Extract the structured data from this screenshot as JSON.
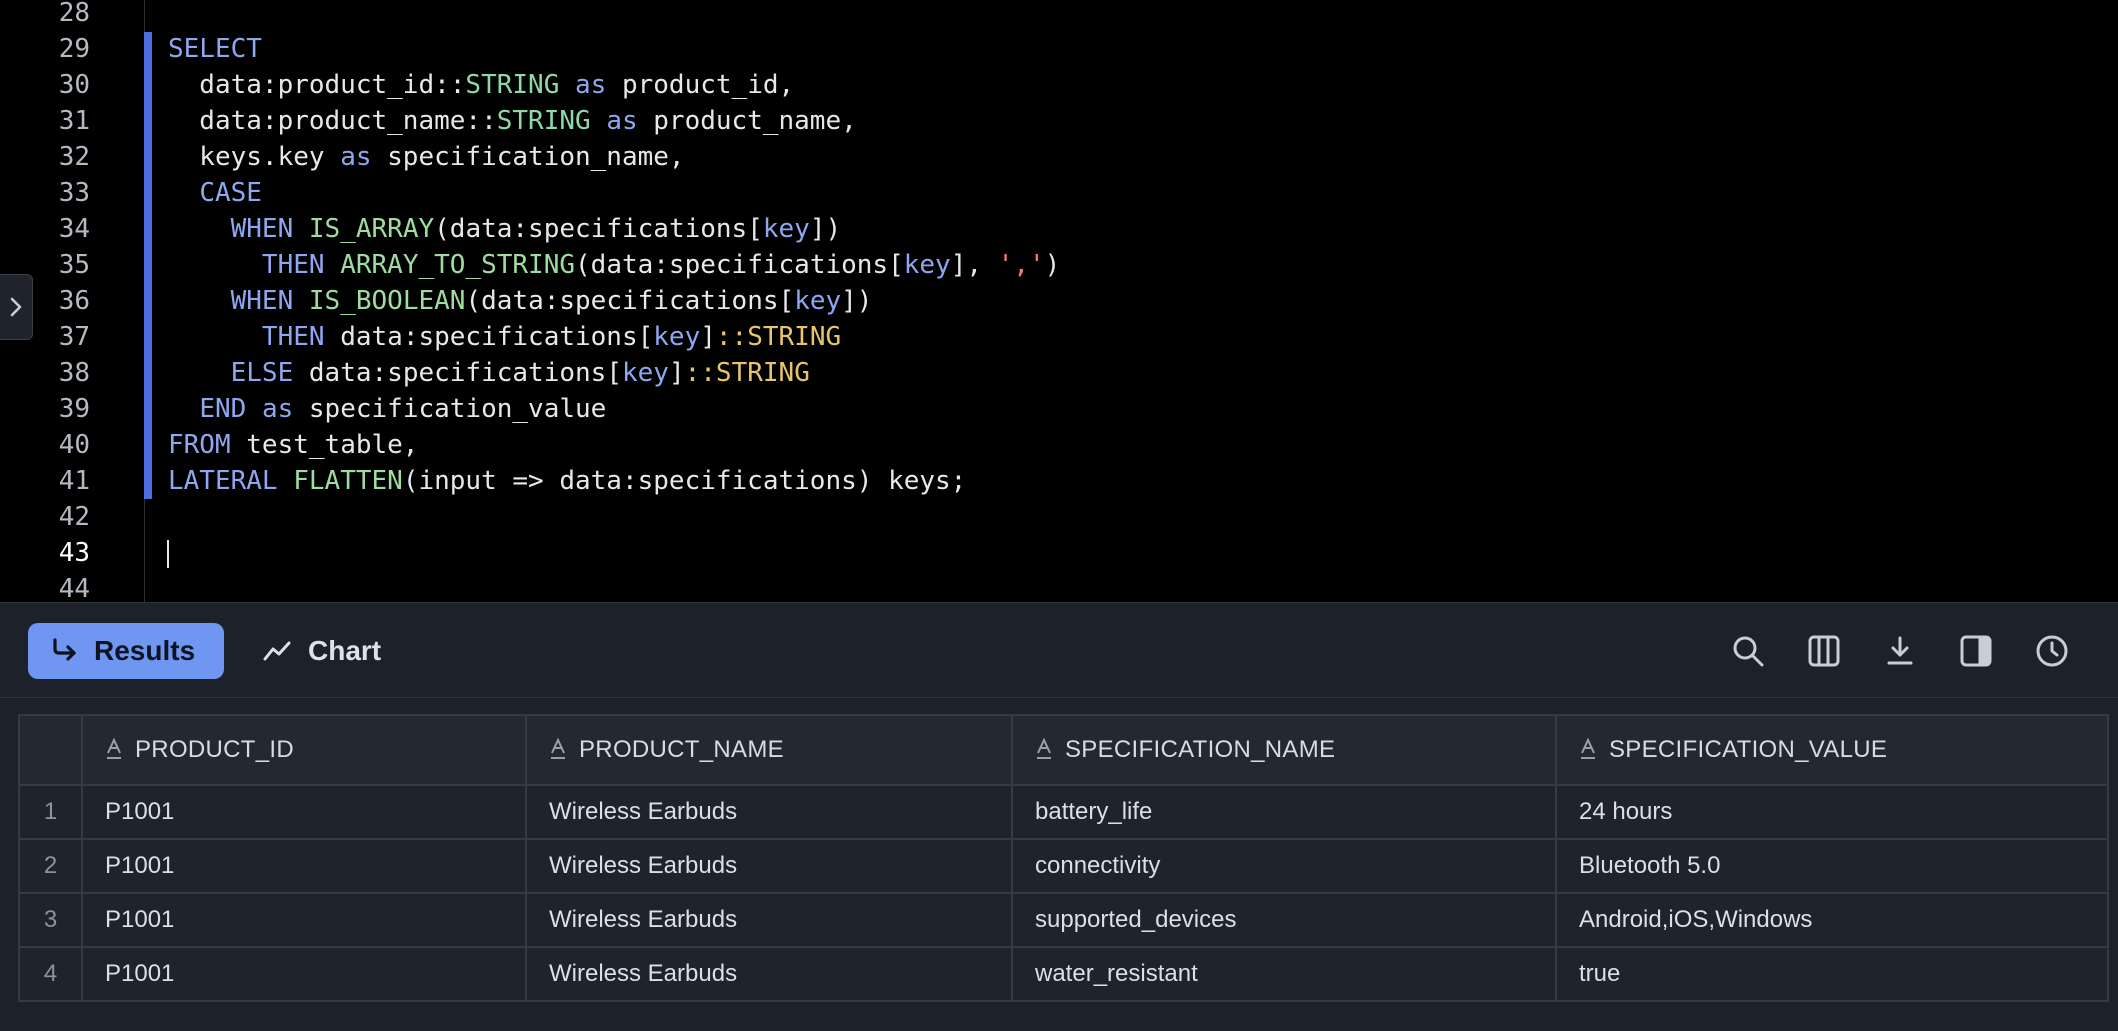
{
  "editor": {
    "lines": [
      {
        "n": "28",
        "tokens": []
      },
      {
        "n": "29",
        "tokens": [
          {
            "t": "SELECT",
            "c": "kw"
          }
        ]
      },
      {
        "n": "30",
        "tokens": [
          {
            "t": "  data:product_id"
          },
          {
            "t": "::",
            "c": "op"
          },
          {
            "t": "STRING",
            "c": "ty"
          },
          {
            "t": " "
          },
          {
            "t": "as",
            "c": "kw"
          },
          {
            "t": " product_id,"
          }
        ]
      },
      {
        "n": "31",
        "tokens": [
          {
            "t": "  data:product_name"
          },
          {
            "t": "::",
            "c": "op"
          },
          {
            "t": "STRING",
            "c": "ty"
          },
          {
            "t": " "
          },
          {
            "t": "as",
            "c": "kw"
          },
          {
            "t": " product_name,"
          }
        ]
      },
      {
        "n": "32",
        "tokens": [
          {
            "t": "  keys.key "
          },
          {
            "t": "as",
            "c": "kw"
          },
          {
            "t": " specification_name,"
          }
        ]
      },
      {
        "n": "33",
        "tokens": [
          {
            "t": "  "
          },
          {
            "t": "CASE",
            "c": "kw"
          }
        ]
      },
      {
        "n": "34",
        "tokens": [
          {
            "t": "    "
          },
          {
            "t": "WHEN",
            "c": "kw"
          },
          {
            "t": " "
          },
          {
            "t": "IS_ARRAY",
            "c": "fn"
          },
          {
            "t": "(data:specifications["
          },
          {
            "t": "key",
            "c": "k"
          },
          {
            "t": "])"
          }
        ]
      },
      {
        "n": "35",
        "tokens": [
          {
            "t": "      "
          },
          {
            "t": "THEN",
            "c": "kw"
          },
          {
            "t": " "
          },
          {
            "t": "ARRAY_TO_STRING",
            "c": "fn"
          },
          {
            "t": "(data:specifications["
          },
          {
            "t": "key",
            "c": "k"
          },
          {
            "t": "], "
          },
          {
            "t": "','",
            "c": "str"
          },
          {
            "t": ")"
          }
        ]
      },
      {
        "n": "36",
        "tokens": [
          {
            "t": "    "
          },
          {
            "t": "WHEN",
            "c": "kw"
          },
          {
            "t": " "
          },
          {
            "t": "IS_BOOLEAN",
            "c": "fn"
          },
          {
            "t": "(data:specifications["
          },
          {
            "t": "key",
            "c": "k"
          },
          {
            "t": "])"
          }
        ]
      },
      {
        "n": "37",
        "tokens": [
          {
            "t": "      "
          },
          {
            "t": "THEN",
            "c": "kw"
          },
          {
            "t": " data:specifications["
          },
          {
            "t": "key",
            "c": "k"
          },
          {
            "t": "]"
          },
          {
            "t": "::",
            "c": "ty2"
          },
          {
            "t": "STRING",
            "c": "ty2"
          }
        ]
      },
      {
        "n": "38",
        "tokens": [
          {
            "t": "    "
          },
          {
            "t": "ELSE",
            "c": "kw"
          },
          {
            "t": " data:specifications["
          },
          {
            "t": "key",
            "c": "k"
          },
          {
            "t": "]"
          },
          {
            "t": "::",
            "c": "ty2"
          },
          {
            "t": "STRING",
            "c": "ty2"
          }
        ]
      },
      {
        "n": "39",
        "tokens": [
          {
            "t": "  "
          },
          {
            "t": "END",
            "c": "kw"
          },
          {
            "t": " "
          },
          {
            "t": "as",
            "c": "kw"
          },
          {
            "t": " specification_value"
          }
        ]
      },
      {
        "n": "40",
        "tokens": [
          {
            "t": "FROM",
            "c": "kw"
          },
          {
            "t": " test_table,"
          }
        ]
      },
      {
        "n": "41",
        "tokens": [
          {
            "t": "LATERAL",
            "c": "kw"
          },
          {
            "t": " "
          },
          {
            "t": "FLATTEN",
            "c": "fn"
          },
          {
            "t": "(input => data:specifications) keys;"
          }
        ]
      },
      {
        "n": "42",
        "tokens": []
      },
      {
        "n": "43",
        "tokens": [],
        "active": true
      },
      {
        "n": "44",
        "tokens": []
      }
    ]
  },
  "toolbar": {
    "results_label": "Results",
    "chart_label": "Chart",
    "tools": [
      "search-icon",
      "columns-icon",
      "download-icon",
      "side-panel-icon",
      "history-icon"
    ]
  },
  "results": {
    "columns": [
      "PRODUCT_ID",
      "PRODUCT_NAME",
      "SPECIFICATION_NAME",
      "SPECIFICATION_VALUE"
    ],
    "rows": [
      {
        "n": "1",
        "cells": [
          "P1001",
          "Wireless Earbuds",
          "battery_life",
          "24 hours"
        ]
      },
      {
        "n": "2",
        "cells": [
          "P1001",
          "Wireless Earbuds",
          "connectivity",
          "Bluetooth 5.0"
        ]
      },
      {
        "n": "3",
        "cells": [
          "P1001",
          "Wireless Earbuds",
          "supported_devices",
          "Android,iOS,Windows"
        ]
      },
      {
        "n": "4",
        "cells": [
          "P1001",
          "Wireless Earbuds",
          "water_resistant",
          "true"
        ]
      }
    ]
  },
  "colors": {
    "accent": "#6f97f2",
    "selection_bar": "#4d6fe0",
    "background": "#000000",
    "panel": "#1d2129"
  }
}
